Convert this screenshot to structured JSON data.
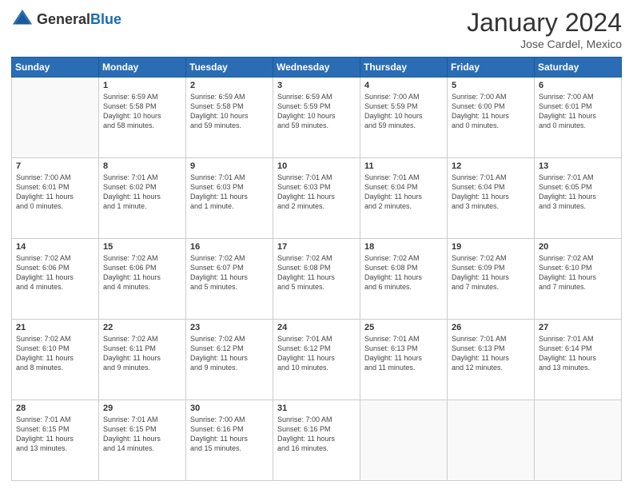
{
  "header": {
    "logo_general": "General",
    "logo_blue": "Blue",
    "month_title": "January 2024",
    "location": "Jose Cardel, Mexico"
  },
  "weekdays": [
    "Sunday",
    "Monday",
    "Tuesday",
    "Wednesday",
    "Thursday",
    "Friday",
    "Saturday"
  ],
  "weeks": [
    [
      {
        "day": "",
        "info": ""
      },
      {
        "day": "1",
        "info": "Sunrise: 6:59 AM\nSunset: 5:58 PM\nDaylight: 10 hours\nand 58 minutes."
      },
      {
        "day": "2",
        "info": "Sunrise: 6:59 AM\nSunset: 5:58 PM\nDaylight: 10 hours\nand 59 minutes."
      },
      {
        "day": "3",
        "info": "Sunrise: 6:59 AM\nSunset: 5:59 PM\nDaylight: 10 hours\nand 59 minutes."
      },
      {
        "day": "4",
        "info": "Sunrise: 7:00 AM\nSunset: 5:59 PM\nDaylight: 10 hours\nand 59 minutes."
      },
      {
        "day": "5",
        "info": "Sunrise: 7:00 AM\nSunset: 6:00 PM\nDaylight: 11 hours\nand 0 minutes."
      },
      {
        "day": "6",
        "info": "Sunrise: 7:00 AM\nSunset: 6:01 PM\nDaylight: 11 hours\nand 0 minutes."
      }
    ],
    [
      {
        "day": "7",
        "info": "Sunrise: 7:00 AM\nSunset: 6:01 PM\nDaylight: 11 hours\nand 0 minutes."
      },
      {
        "day": "8",
        "info": "Sunrise: 7:01 AM\nSunset: 6:02 PM\nDaylight: 11 hours\nand 1 minute."
      },
      {
        "day": "9",
        "info": "Sunrise: 7:01 AM\nSunset: 6:03 PM\nDaylight: 11 hours\nand 1 minute."
      },
      {
        "day": "10",
        "info": "Sunrise: 7:01 AM\nSunset: 6:03 PM\nDaylight: 11 hours\nand 2 minutes."
      },
      {
        "day": "11",
        "info": "Sunrise: 7:01 AM\nSunset: 6:04 PM\nDaylight: 11 hours\nand 2 minutes."
      },
      {
        "day": "12",
        "info": "Sunrise: 7:01 AM\nSunset: 6:04 PM\nDaylight: 11 hours\nand 3 minutes."
      },
      {
        "day": "13",
        "info": "Sunrise: 7:01 AM\nSunset: 6:05 PM\nDaylight: 11 hours\nand 3 minutes."
      }
    ],
    [
      {
        "day": "14",
        "info": "Sunrise: 7:02 AM\nSunset: 6:06 PM\nDaylight: 11 hours\nand 4 minutes."
      },
      {
        "day": "15",
        "info": "Sunrise: 7:02 AM\nSunset: 6:06 PM\nDaylight: 11 hours\nand 4 minutes."
      },
      {
        "day": "16",
        "info": "Sunrise: 7:02 AM\nSunset: 6:07 PM\nDaylight: 11 hours\nand 5 minutes."
      },
      {
        "day": "17",
        "info": "Sunrise: 7:02 AM\nSunset: 6:08 PM\nDaylight: 11 hours\nand 5 minutes."
      },
      {
        "day": "18",
        "info": "Sunrise: 7:02 AM\nSunset: 6:08 PM\nDaylight: 11 hours\nand 6 minutes."
      },
      {
        "day": "19",
        "info": "Sunrise: 7:02 AM\nSunset: 6:09 PM\nDaylight: 11 hours\nand 7 minutes."
      },
      {
        "day": "20",
        "info": "Sunrise: 7:02 AM\nSunset: 6:10 PM\nDaylight: 11 hours\nand 7 minutes."
      }
    ],
    [
      {
        "day": "21",
        "info": "Sunrise: 7:02 AM\nSunset: 6:10 PM\nDaylight: 11 hours\nand 8 minutes."
      },
      {
        "day": "22",
        "info": "Sunrise: 7:02 AM\nSunset: 6:11 PM\nDaylight: 11 hours\nand 9 minutes."
      },
      {
        "day": "23",
        "info": "Sunrise: 7:02 AM\nSunset: 6:12 PM\nDaylight: 11 hours\nand 9 minutes."
      },
      {
        "day": "24",
        "info": "Sunrise: 7:01 AM\nSunset: 6:12 PM\nDaylight: 11 hours\nand 10 minutes."
      },
      {
        "day": "25",
        "info": "Sunrise: 7:01 AM\nSunset: 6:13 PM\nDaylight: 11 hours\nand 11 minutes."
      },
      {
        "day": "26",
        "info": "Sunrise: 7:01 AM\nSunset: 6:13 PM\nDaylight: 11 hours\nand 12 minutes."
      },
      {
        "day": "27",
        "info": "Sunrise: 7:01 AM\nSunset: 6:14 PM\nDaylight: 11 hours\nand 13 minutes."
      }
    ],
    [
      {
        "day": "28",
        "info": "Sunrise: 7:01 AM\nSunset: 6:15 PM\nDaylight: 11 hours\nand 13 minutes."
      },
      {
        "day": "29",
        "info": "Sunrise: 7:01 AM\nSunset: 6:15 PM\nDaylight: 11 hours\nand 14 minutes."
      },
      {
        "day": "30",
        "info": "Sunrise: 7:00 AM\nSunset: 6:16 PM\nDaylight: 11 hours\nand 15 minutes."
      },
      {
        "day": "31",
        "info": "Sunrise: 7:00 AM\nSunset: 6:16 PM\nDaylight: 11 hours\nand 16 minutes."
      },
      {
        "day": "",
        "info": ""
      },
      {
        "day": "",
        "info": ""
      },
      {
        "day": "",
        "info": ""
      }
    ]
  ]
}
